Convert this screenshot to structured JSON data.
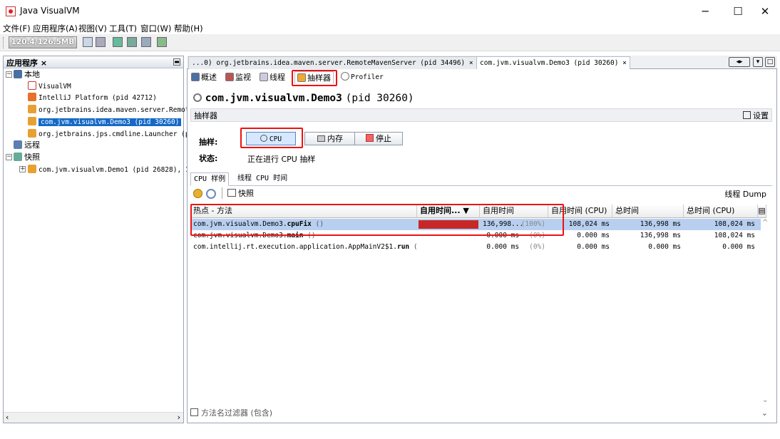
{
  "window": {
    "title": "Java VisualVM"
  },
  "menu": {
    "items": [
      "文件(F)",
      "应用程序(A)",
      "视图(V)",
      "工具(T)",
      "窗口(W)",
      "帮助(H)"
    ]
  },
  "toolbar": {
    "memory": "120.4/126.5MB"
  },
  "left_panel": {
    "title": "应用程序 ×",
    "tree": [
      {
        "label": "本地"
      },
      {
        "label": "VisualVM"
      },
      {
        "label": "IntelliJ Platform (pid 42712)"
      },
      {
        "label": "org.jetbrains.idea.maven.server.Remote"
      },
      {
        "label": "com.jvm.visualvm.Demo3 (pid 30260)"
      },
      {
        "label": "org.jetbrains.jps.cmdline.Launcher (pi"
      },
      {
        "label": "远程"
      },
      {
        "label": "快照"
      },
      {
        "label": "com.jvm.visualvm.Demo1 (pid 26828), 13"
      }
    ]
  },
  "doc_tabs": [
    {
      "label": "...0) org.jetbrains.idea.maven.server.RemoteMavenServer (pid 34496)  ×"
    },
    {
      "label": "com.jvm.visualvm.Demo3 (pid 30260)  ×"
    }
  ],
  "view_tabs": [
    "概述",
    "监视",
    "线程",
    "抽样器",
    "Profiler"
  ],
  "process": {
    "name": "com.jvm.visualvm.Demo3",
    "pid": "(pid 30260)"
  },
  "sampler": {
    "header": "抽样器",
    "settings_label": "设置",
    "sample_label": "抽样:",
    "cpu_button": "CPU",
    "memory_button": "内存",
    "stop_button": "停止",
    "status_label": "状态:",
    "status_value": "正在进行 CPU 抽样"
  },
  "sub_tabs": [
    "CPU 样例",
    "线程 CPU 时间"
  ],
  "results_toolbar": {
    "snapshot": "快照",
    "thread_dump": "线程 Dump"
  },
  "table": {
    "columns": [
      "热点 - 方法",
      "自用时间... ▼",
      "自用时间",
      "自用时间 (CPU)",
      "总时间",
      "总时间 (CPU)"
    ],
    "rows": [
      {
        "method_prefix": "com.jvm.visualvm.Demo3.",
        "method_bold": "cpuFix",
        "method_suffix": " ()",
        "self_bar": 1.0,
        "self_time": "136,998...",
        "self_pct": "(100%)",
        "self_cpu": "108,024 ms",
        "total": "136,998 ms",
        "total_cpu": "108,024 ms"
      },
      {
        "method_prefix": "com.jvm.visualvm.Demo3.",
        "method_bold": "main",
        "method_suffix": " ()",
        "self_bar": 0.0,
        "self_time": "0.000 ms",
        "self_pct": "(0%)",
        "self_cpu": "0.000 ms",
        "total": "136,998 ms",
        "total_cpu": "108,024 ms"
      },
      {
        "method_prefix": "com.intellij.rt.execution.application.AppMainV2$1.",
        "method_bold": "run",
        "method_suffix": " ()",
        "self_bar": 0.0,
        "self_time": "0.000 ms",
        "self_pct": "(0%)",
        "self_cpu": "0.000 ms",
        "total": "0.000 ms",
        "total_cpu": "0.000 ms"
      }
    ]
  },
  "filter": {
    "placeholder": "方法名过滤器 (包含)"
  },
  "colors": {
    "highlight": "#e11",
    "selection": "#1569c7",
    "bar": "#c62828"
  }
}
